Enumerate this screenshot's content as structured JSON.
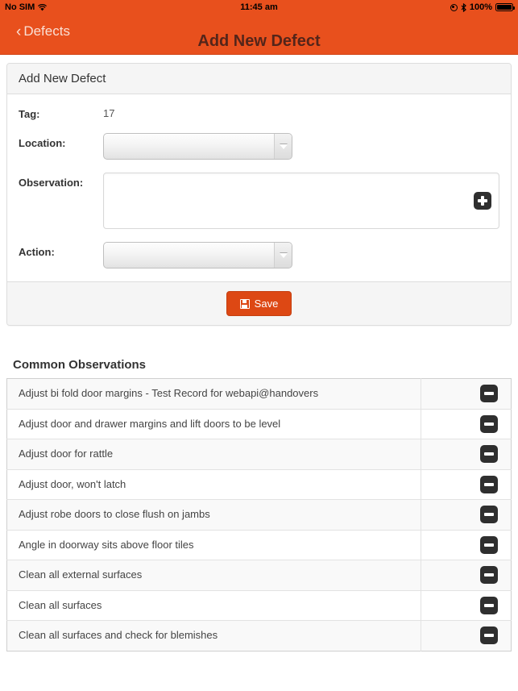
{
  "statusbar": {
    "carrier": "No SIM",
    "wifi_icon": "wifi-icon",
    "time": "11:45 am",
    "rotation_lock_icon": "rotation-lock-icon",
    "bluetooth_icon": "bluetooth-icon",
    "battery_percent": "100%",
    "battery_icon": "battery-icon"
  },
  "navbar": {
    "back_chevron": "‹",
    "back_label": "Defects",
    "title": "Add New Defect",
    "bg_color": "#e8501d",
    "title_color": "#54251a",
    "back_color": "#fadfd4"
  },
  "panel": {
    "heading": "Add New Defect",
    "fields": {
      "tag": {
        "label": "Tag:",
        "value": "17"
      },
      "location": {
        "label": "Location:",
        "value": "",
        "placeholder": "",
        "arrow_icon": "chevron-down-icon"
      },
      "observation": {
        "label": "Observation:",
        "value": "",
        "placeholder": "",
        "add_icon": "plus-icon"
      },
      "action": {
        "label": "Action:",
        "value": "",
        "placeholder": "",
        "arrow_icon": "chevron-down-icon"
      }
    },
    "save": {
      "label": "Save",
      "icon": "floppy-save-icon",
      "color": "#dd4814"
    }
  },
  "common_observations": {
    "title": "Common Observations",
    "remove_icon": "minus-icon",
    "rows": [
      {
        "text": "Adjust bi fold door margins - Test Record for webapi@handovers"
      },
      {
        "text": "Adjust door and drawer margins and lift doors to be level"
      },
      {
        "text": "Adjust door for rattle"
      },
      {
        "text": "Adjust door, won't latch"
      },
      {
        "text": "Adjust robe doors to close flush on jambs"
      },
      {
        "text": "Angle in doorway sits above floor tiles"
      },
      {
        "text": "Clean all external surfaces"
      },
      {
        "text": "Clean all surfaces"
      },
      {
        "text": "Clean all surfaces and check for blemishes"
      }
    ]
  }
}
